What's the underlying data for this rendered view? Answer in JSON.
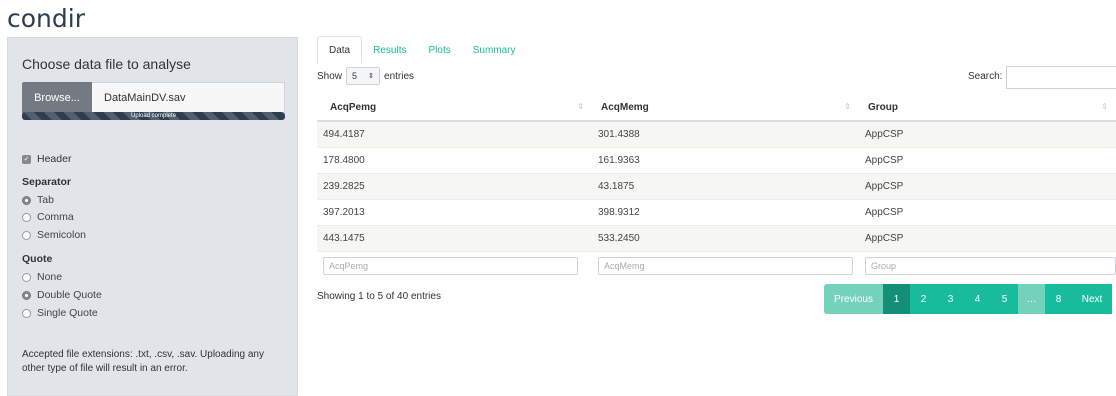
{
  "app_title": "condir",
  "sidebar": {
    "title": "Choose data file to analyse",
    "browse_label": "Browse...",
    "file_name": "DataMainDV.sav",
    "upload_status": "Upload complete",
    "upload_progress": 1.0,
    "header_label": "Header",
    "separator_label": "Separator",
    "separator_options": [
      "Tab",
      "Comma",
      "Semicolon"
    ],
    "separator_selected": "Tab",
    "quote_label": "Quote",
    "quote_options": [
      "None",
      "Double Quote",
      "Single Quote"
    ],
    "quote_selected": "Double Quote",
    "note": "Accepted file extensions: .txt, .csv, .sav. Uploading any other type of file will result in an error."
  },
  "tabs": [
    "Data",
    "Results",
    "Plots",
    "Summary"
  ],
  "active_tab": "Data",
  "length_menu": {
    "show": "Show",
    "value": "5",
    "entries": "entries"
  },
  "search_label": "Search:",
  "table": {
    "columns": [
      "AcqPemg",
      "AcqMemg",
      "Group"
    ],
    "rows": [
      [
        "494.4187",
        "301.4388",
        "AppCSP"
      ],
      [
        "178.4800",
        "161.9363",
        "AppCSP"
      ],
      [
        "239.2825",
        "43.1875",
        "AppCSP"
      ],
      [
        "397.2013",
        "398.9312",
        "AppCSP"
      ],
      [
        "443.1475",
        "533.2450",
        "AppCSP"
      ]
    ],
    "filter_placeholders": [
      "AcqPemg",
      "AcqMemg",
      "Group"
    ]
  },
  "info": "Showing 1 to 5 of 40 entries",
  "pagination": {
    "previous": "Previous",
    "pages": [
      "1",
      "2",
      "3",
      "4",
      "5"
    ],
    "ellipsis": "…",
    "last": "8",
    "next": "Next"
  },
  "colors": {
    "accent": "#18bc9c",
    "accent_active": "#128f76",
    "title": "#2c3e50",
    "sidebar_bg": "#e1e4e8"
  }
}
